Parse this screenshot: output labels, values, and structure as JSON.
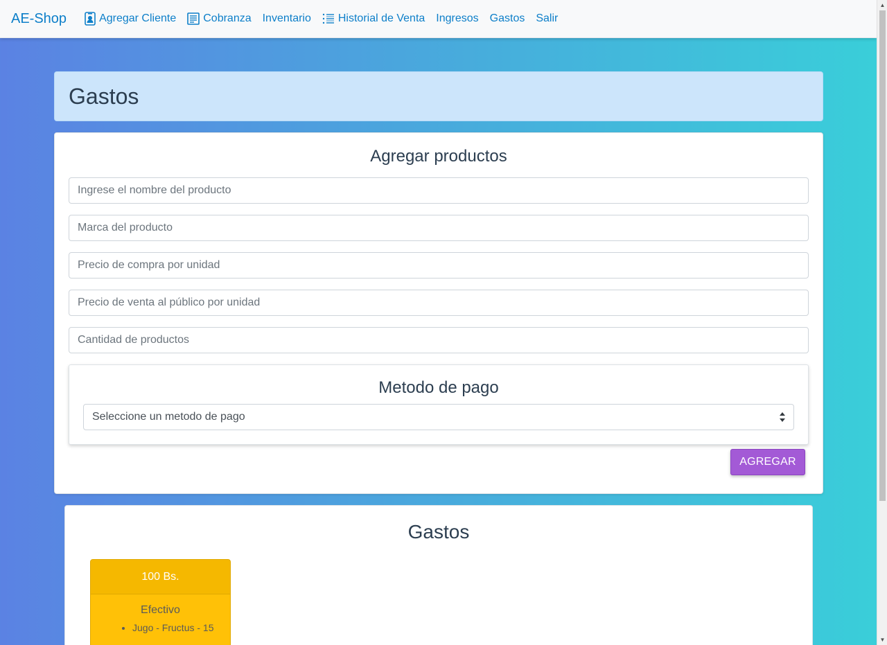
{
  "navbar": {
    "brand": "AE-Shop",
    "items": [
      {
        "label": "Agregar Cliente",
        "icon": "person-badge-icon"
      },
      {
        "label": "Cobranza",
        "icon": "document-list-icon"
      },
      {
        "label": "Inventario",
        "icon": ""
      },
      {
        "label": "Historial de Venta",
        "icon": "list-icon"
      },
      {
        "label": "Ingresos",
        "icon": ""
      },
      {
        "label": "Gastos",
        "icon": ""
      },
      {
        "label": "Salir",
        "icon": ""
      }
    ]
  },
  "header": {
    "title": "Gastos"
  },
  "form": {
    "title": "Agregar productos",
    "fields": {
      "name_placeholder": "Ingrese el nombre del producto",
      "brand_placeholder": "Marca del producto",
      "buy_price_placeholder": "Precio de compra por unidad",
      "sell_price_placeholder": "Precio de venta al público por unidad",
      "quantity_placeholder": "Cantidad de productos"
    },
    "payment": {
      "title": "Metodo de pago",
      "selected": "Seleccione un metodo de pago"
    },
    "submit_label": "AGREGAR"
  },
  "expenses": {
    "title": "Gastos",
    "items": [
      {
        "amount": "100 Bs.",
        "method": "Efectivo",
        "entries": [
          "Jugo - Fructus - 15"
        ]
      }
    ]
  },
  "colors": {
    "link": "#0d7fc9",
    "button": "#a35ad6",
    "expense_card": "#ffc107",
    "header_bg": "#cce5fb"
  }
}
